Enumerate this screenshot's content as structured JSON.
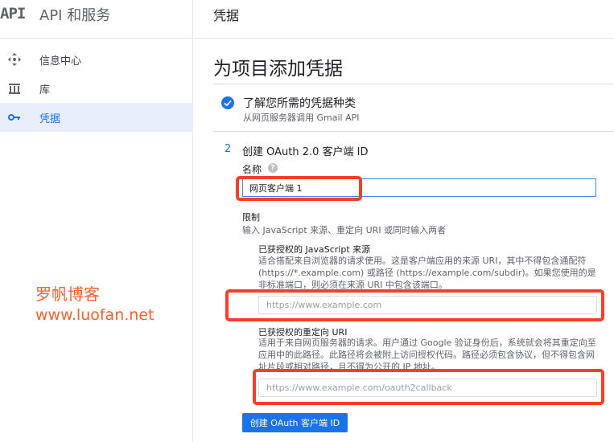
{
  "sidebar": {
    "logo": "API",
    "title": "API 和服务",
    "items": [
      {
        "label": "信息中心",
        "icon": "dashboard-icon"
      },
      {
        "label": "库",
        "icon": "library-icon"
      },
      {
        "label": "凭据",
        "icon": "key-icon",
        "active": true
      }
    ]
  },
  "header": {
    "title": "凭据"
  },
  "page": {
    "title": "为项目添加凭据"
  },
  "step1": {
    "title": "了解您所需的凭据种类",
    "subtitle": "从网页服务器调用 Gmail API",
    "icon": "check-circle-icon"
  },
  "step2": {
    "number": "2",
    "title": "创建 OAuth 2.0 客户端 ID",
    "name_label": "名称",
    "help_icon": "help-icon",
    "name_value": "网页客户端 1",
    "restrictions_label": "限制",
    "restrictions_desc": "输入 JavaScript 来源、重定向 URI 或同时输入两者",
    "js_origins": {
      "title": "已获授权的 JavaScript 来源",
      "desc": "适合搭配来自浏览器的请求使用。这是客户端应用的来源 URI，其中不得包含通配符 (https://*.example.com) 或路径 (https://example.com/subdir)。如果您使用的是非标准端口，则必须在来源 URI 中包含该端口。",
      "placeholder": "https://www.example.com"
    },
    "redirect_uris": {
      "title": "已获授权的重定向 URI",
      "desc": "适用于来自网页服务器的请求。用户通过 Google 验证身份后，系统就会将其重定向至应用中的此路径。此路径将会被附上访问授权代码。路径必须包含协议，但不得包含网址片段或相对路径，且不得为公开的 IP 地址。",
      "placeholder": "https://www.example.com/oauth2callback"
    },
    "create_button": "创建 OAuth 客户端 ID"
  },
  "watermark": {
    "line1": "罗帆博客",
    "line2": "www.luofan.net"
  },
  "colors": {
    "accent": "#1a73e8",
    "highlight": "#f43f2a",
    "watermark": "#f2642f",
    "active_bg": "#e8eefb"
  }
}
